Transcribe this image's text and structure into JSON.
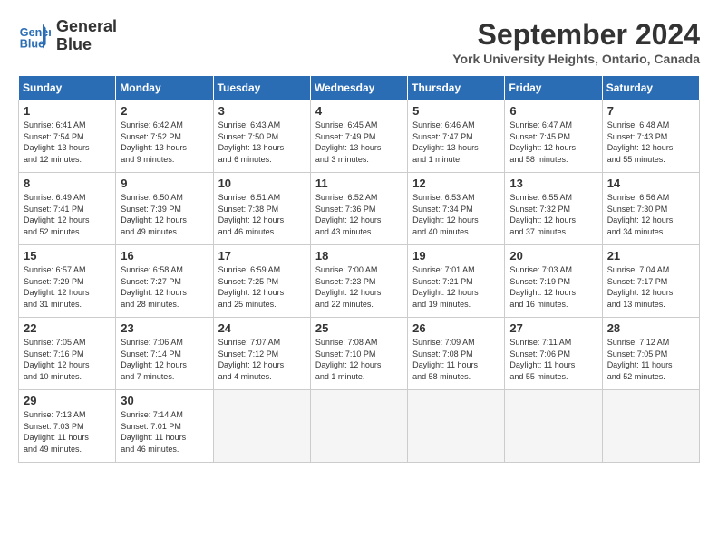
{
  "logo": {
    "line1": "General",
    "line2": "Blue"
  },
  "title": "September 2024",
  "subtitle": "York University Heights, Ontario, Canada",
  "days_of_week": [
    "Sunday",
    "Monday",
    "Tuesday",
    "Wednesday",
    "Thursday",
    "Friday",
    "Saturday"
  ],
  "weeks": [
    [
      {
        "day": "1",
        "details": "Sunrise: 6:41 AM\nSunset: 7:54 PM\nDaylight: 13 hours\nand 12 minutes."
      },
      {
        "day": "2",
        "details": "Sunrise: 6:42 AM\nSunset: 7:52 PM\nDaylight: 13 hours\nand 9 minutes."
      },
      {
        "day": "3",
        "details": "Sunrise: 6:43 AM\nSunset: 7:50 PM\nDaylight: 13 hours\nand 6 minutes."
      },
      {
        "day": "4",
        "details": "Sunrise: 6:45 AM\nSunset: 7:49 PM\nDaylight: 13 hours\nand 3 minutes."
      },
      {
        "day": "5",
        "details": "Sunrise: 6:46 AM\nSunset: 7:47 PM\nDaylight: 13 hours\nand 1 minute."
      },
      {
        "day": "6",
        "details": "Sunrise: 6:47 AM\nSunset: 7:45 PM\nDaylight: 12 hours\nand 58 minutes."
      },
      {
        "day": "7",
        "details": "Sunrise: 6:48 AM\nSunset: 7:43 PM\nDaylight: 12 hours\nand 55 minutes."
      }
    ],
    [
      {
        "day": "8",
        "details": "Sunrise: 6:49 AM\nSunset: 7:41 PM\nDaylight: 12 hours\nand 52 minutes."
      },
      {
        "day": "9",
        "details": "Sunrise: 6:50 AM\nSunset: 7:39 PM\nDaylight: 12 hours\nand 49 minutes."
      },
      {
        "day": "10",
        "details": "Sunrise: 6:51 AM\nSunset: 7:38 PM\nDaylight: 12 hours\nand 46 minutes."
      },
      {
        "day": "11",
        "details": "Sunrise: 6:52 AM\nSunset: 7:36 PM\nDaylight: 12 hours\nand 43 minutes."
      },
      {
        "day": "12",
        "details": "Sunrise: 6:53 AM\nSunset: 7:34 PM\nDaylight: 12 hours\nand 40 minutes."
      },
      {
        "day": "13",
        "details": "Sunrise: 6:55 AM\nSunset: 7:32 PM\nDaylight: 12 hours\nand 37 minutes."
      },
      {
        "day": "14",
        "details": "Sunrise: 6:56 AM\nSunset: 7:30 PM\nDaylight: 12 hours\nand 34 minutes."
      }
    ],
    [
      {
        "day": "15",
        "details": "Sunrise: 6:57 AM\nSunset: 7:29 PM\nDaylight: 12 hours\nand 31 minutes."
      },
      {
        "day": "16",
        "details": "Sunrise: 6:58 AM\nSunset: 7:27 PM\nDaylight: 12 hours\nand 28 minutes."
      },
      {
        "day": "17",
        "details": "Sunrise: 6:59 AM\nSunset: 7:25 PM\nDaylight: 12 hours\nand 25 minutes."
      },
      {
        "day": "18",
        "details": "Sunrise: 7:00 AM\nSunset: 7:23 PM\nDaylight: 12 hours\nand 22 minutes."
      },
      {
        "day": "19",
        "details": "Sunrise: 7:01 AM\nSunset: 7:21 PM\nDaylight: 12 hours\nand 19 minutes."
      },
      {
        "day": "20",
        "details": "Sunrise: 7:03 AM\nSunset: 7:19 PM\nDaylight: 12 hours\nand 16 minutes."
      },
      {
        "day": "21",
        "details": "Sunrise: 7:04 AM\nSunset: 7:17 PM\nDaylight: 12 hours\nand 13 minutes."
      }
    ],
    [
      {
        "day": "22",
        "details": "Sunrise: 7:05 AM\nSunset: 7:16 PM\nDaylight: 12 hours\nand 10 minutes."
      },
      {
        "day": "23",
        "details": "Sunrise: 7:06 AM\nSunset: 7:14 PM\nDaylight: 12 hours\nand 7 minutes."
      },
      {
        "day": "24",
        "details": "Sunrise: 7:07 AM\nSunset: 7:12 PM\nDaylight: 12 hours\nand 4 minutes."
      },
      {
        "day": "25",
        "details": "Sunrise: 7:08 AM\nSunset: 7:10 PM\nDaylight: 12 hours\nand 1 minute."
      },
      {
        "day": "26",
        "details": "Sunrise: 7:09 AM\nSunset: 7:08 PM\nDaylight: 11 hours\nand 58 minutes."
      },
      {
        "day": "27",
        "details": "Sunrise: 7:11 AM\nSunset: 7:06 PM\nDaylight: 11 hours\nand 55 minutes."
      },
      {
        "day": "28",
        "details": "Sunrise: 7:12 AM\nSunset: 7:05 PM\nDaylight: 11 hours\nand 52 minutes."
      }
    ],
    [
      {
        "day": "29",
        "details": "Sunrise: 7:13 AM\nSunset: 7:03 PM\nDaylight: 11 hours\nand 49 minutes."
      },
      {
        "day": "30",
        "details": "Sunrise: 7:14 AM\nSunset: 7:01 PM\nDaylight: 11 hours\nand 46 minutes."
      },
      {
        "day": "",
        "details": ""
      },
      {
        "day": "",
        "details": ""
      },
      {
        "day": "",
        "details": ""
      },
      {
        "day": "",
        "details": ""
      },
      {
        "day": "",
        "details": ""
      }
    ]
  ]
}
